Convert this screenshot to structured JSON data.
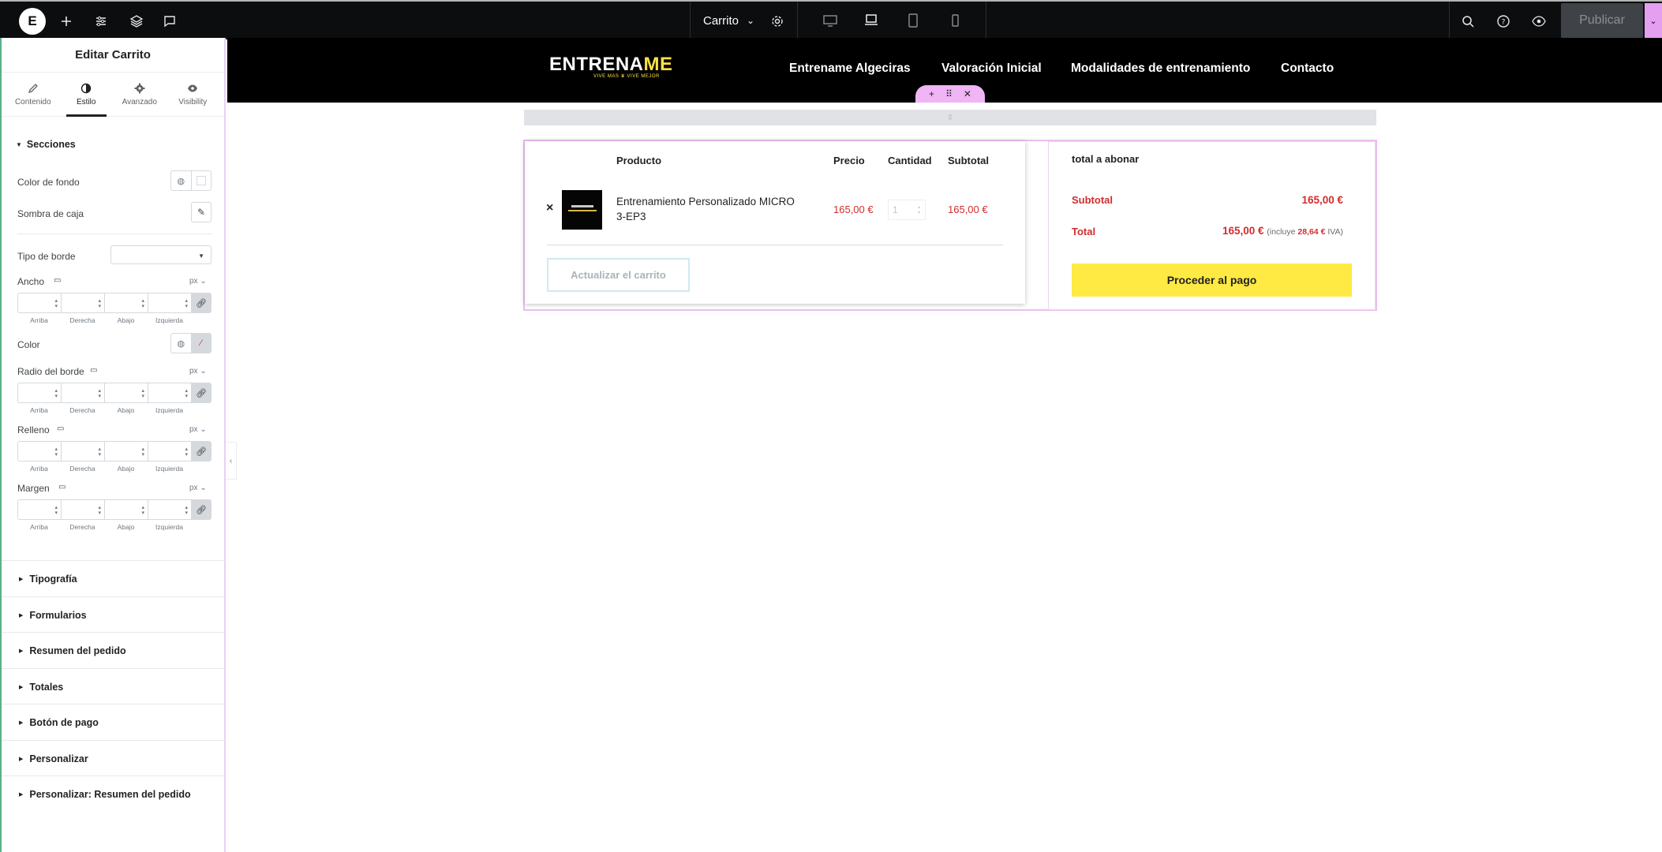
{
  "topbar": {
    "logo": "E",
    "document_title": "Carrito",
    "publish_label": "Publicar"
  },
  "panel": {
    "title": "Editar Carrito",
    "tabs": [
      {
        "label": "Contenido",
        "icon": "pencil-icon",
        "active": false
      },
      {
        "label": "Estilo",
        "icon": "contrast-icon",
        "active": true
      },
      {
        "label": "Avanzado",
        "icon": "gear-icon",
        "active": false
      },
      {
        "label": "Visibility",
        "icon": "eye-icon",
        "active": false
      }
    ],
    "sections_title": "Secciones",
    "bg_color_label": "Color de fondo",
    "box_shadow_label": "Sombra de caja",
    "border_type_label": "Tipo de borde",
    "border_type_value": "",
    "width_label": "Ancho",
    "color_label": "Color",
    "radius_label": "Radio del borde",
    "padding_label": "Relleno",
    "margin_label": "Margen",
    "unit": "px",
    "dim_labels": [
      "Arriba",
      "Derecha",
      "Abajo",
      "Izquierda"
    ],
    "collapsed_sections": [
      "Tipografía",
      "Formularios",
      "Resumen del pedido",
      "Totales",
      "Botón de pago",
      "Personalizar",
      "Personalizar: Resumen del pedido"
    ]
  },
  "site": {
    "brand_main": "ENTRENA",
    "brand_accent": "ME",
    "brand_tagline": "VIVE MAS ♛ VIVE MEJOR",
    "nav": [
      "Entrename Algeciras",
      "Valoración Inicial",
      "Modalidades de entrenamiento",
      "Contacto"
    ]
  },
  "cart": {
    "headers": {
      "product": "Producto",
      "price": "Precio",
      "quantity": "Cantidad",
      "subtotal": "Subtotal"
    },
    "remove_symbol": "×",
    "item": {
      "name": "Entrenamiento Personalizado MICRO 3-EP3",
      "price": "165,00 €",
      "quantity": "1",
      "subtotal": "165,00 €"
    },
    "update_label": "Actualizar el carrito"
  },
  "totals": {
    "title": "total a abonar",
    "subtotal_label": "Subtotal",
    "subtotal_value": "165,00 €",
    "total_label": "Total",
    "total_value": "165,00 €",
    "tax_prefix": "(incluye",
    "tax_value": "28,64 €",
    "tax_suffix": "IVA)",
    "checkout_label": "Proceder al pago"
  },
  "colors": {
    "accent_yellow": "#ffe943",
    "price_red": "#cf2e2e",
    "editor_pink": "#e49ff0",
    "topbar_bg": "#0c0d0e"
  }
}
